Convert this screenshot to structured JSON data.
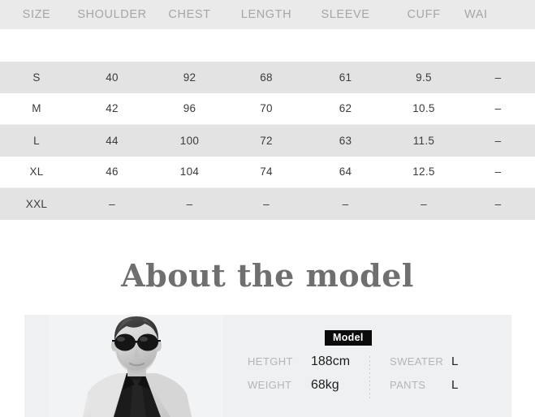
{
  "size_table": {
    "columns": [
      "SIZE",
      "SHOULDER",
      "CHEST",
      "LENGTH",
      "SLEEVE",
      "CUFF",
      "WAI"
    ],
    "rows": [
      {
        "size": "S",
        "shoulder": "40",
        "chest": "92",
        "length": "68",
        "sleeve": "61",
        "cuff": "9.5",
        "waist": "–"
      },
      {
        "size": "M",
        "shoulder": "42",
        "chest": "96",
        "length": "70",
        "sleeve": "62",
        "cuff": "10.5",
        "waist": "–"
      },
      {
        "size": "L",
        "shoulder": "44",
        "chest": "100",
        "length": "72",
        "sleeve": "63",
        "cuff": "11.5",
        "waist": "–"
      },
      {
        "size": "XL",
        "shoulder": "46",
        "chest": "104",
        "length": "74",
        "sleeve": "64",
        "cuff": "12.5",
        "waist": "–"
      },
      {
        "size": "XXL",
        "shoulder": "–",
        "chest": "–",
        "length": "–",
        "sleeve": "–",
        "cuff": "–",
        "waist": "–"
      }
    ]
  },
  "about": {
    "heading": "About the model"
  },
  "model": {
    "badge": "Model",
    "photo_alt": "model-photograph",
    "specs_left": [
      {
        "label": "HETGHT",
        "value": "188cm"
      },
      {
        "label": "WEIGHT",
        "value": "68kg"
      }
    ],
    "specs_right": [
      {
        "label": "SWEATER",
        "value": "L"
      },
      {
        "label": "PANTS",
        "value": "L"
      }
    ]
  },
  "colors": {
    "header_band": "#eaeaea",
    "row_shade": "#e3e3e3",
    "header_text": "#a6a6a6",
    "body_text": "#3b3b3b",
    "heading_text": "#6f6f6f",
    "panel_bg": "#eef0f1",
    "badge_bg": "#0b0b0b",
    "badge_text": "#ffffff",
    "spec_label": "#b3b5b7",
    "spec_value": "#1d1d1d"
  }
}
